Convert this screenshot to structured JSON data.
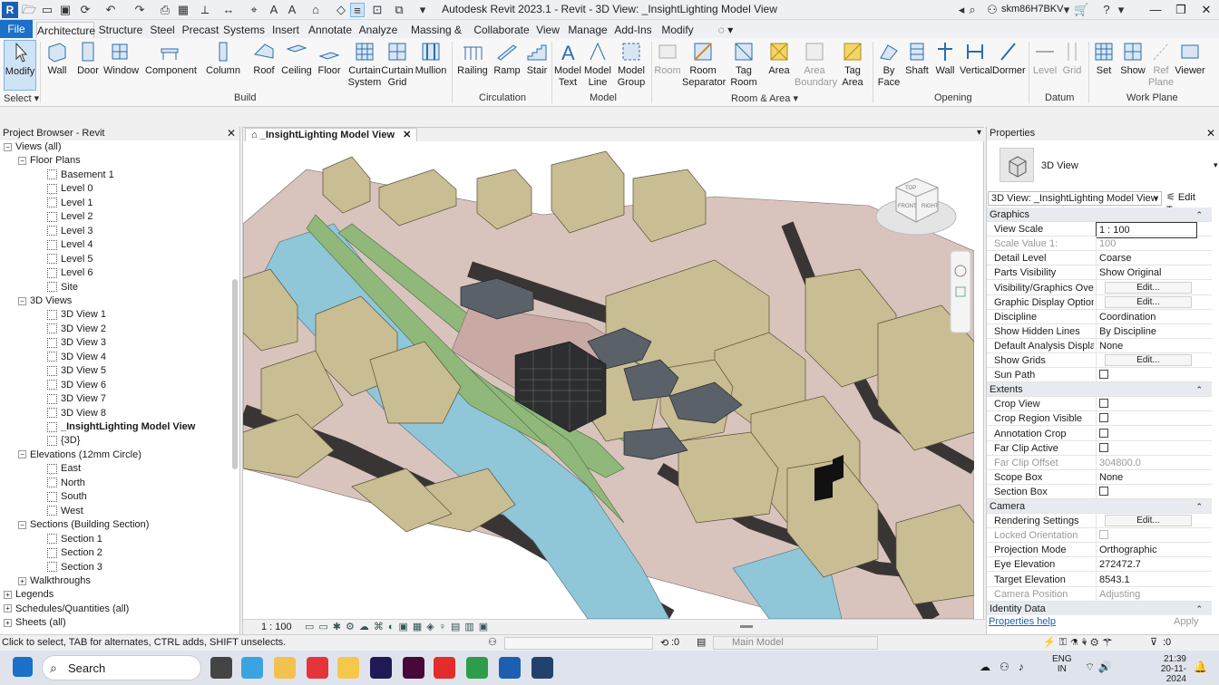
{
  "window": {
    "title": "Autodesk Revit 2023.1 - Revit - 3D View: _InsightLighting Model View",
    "user": "skm86H7BKV"
  },
  "tabs": [
    "File",
    "Architecture",
    "Structure",
    "Steel",
    "Precast",
    "Systems",
    "Insert",
    "Annotate",
    "Analyze",
    "Massing & Site",
    "Collaborate",
    "View",
    "Manage",
    "Add-Ins",
    "Modify"
  ],
  "active_tab": "Architecture",
  "ribbon": {
    "select": {
      "modify": "Modify",
      "label": "Select"
    },
    "build": {
      "label": "Build",
      "items": [
        "Wall",
        "Door",
        "Window",
        "Component",
        "Column",
        "Roof",
        "Ceiling",
        "Floor",
        "Curtain System",
        "Curtain Grid",
        "Mullion"
      ]
    },
    "circulation": {
      "label": "Circulation",
      "items": [
        "Railing",
        "Ramp",
        "Stair"
      ]
    },
    "model": {
      "label": "Model",
      "items": [
        "Model Text",
        "Model Line",
        "Model Group"
      ]
    },
    "room_area": {
      "label": "Room & Area",
      "items": [
        "Room",
        "Room Separator",
        "Tag Room",
        "Area",
        "Area Boundary",
        "Tag Area"
      ]
    },
    "opening": {
      "label": "Opening",
      "items": [
        "By Face",
        "Shaft",
        "Wall",
        "Vertical",
        "Dormer"
      ]
    },
    "datum": {
      "label": "Datum",
      "items": [
        "Level",
        "Grid"
      ]
    },
    "work_plane": {
      "label": "Work Plane",
      "items": [
        "Set",
        "Show",
        "Ref Plane",
        "Viewer"
      ]
    }
  },
  "project_browser": {
    "title": "Project Browser - Revit",
    "nodes": [
      {
        "label": "Views (all)",
        "level": 0,
        "type": "root"
      },
      {
        "label": "Floor Plans",
        "level": 1,
        "type": "group"
      },
      {
        "label": "Basement 1",
        "level": 2,
        "type": "view"
      },
      {
        "label": "Level 0",
        "level": 2,
        "type": "view"
      },
      {
        "label": "Level 1",
        "level": 2,
        "type": "view"
      },
      {
        "label": "Level 2",
        "level": 2,
        "type": "view"
      },
      {
        "label": "Level 3",
        "level": 2,
        "type": "view"
      },
      {
        "label": "Level 4",
        "level": 2,
        "type": "view"
      },
      {
        "label": "Level 5",
        "level": 2,
        "type": "view"
      },
      {
        "label": "Level 6",
        "level": 2,
        "type": "view"
      },
      {
        "label": "Site",
        "level": 2,
        "type": "view"
      },
      {
        "label": "3D Views",
        "level": 1,
        "type": "group"
      },
      {
        "label": "3D View 1",
        "level": 2,
        "type": "view"
      },
      {
        "label": "3D View 2",
        "level": 2,
        "type": "view"
      },
      {
        "label": "3D View 3",
        "level": 2,
        "type": "view"
      },
      {
        "label": "3D View 4",
        "level": 2,
        "type": "view"
      },
      {
        "label": "3D View 5",
        "level": 2,
        "type": "view"
      },
      {
        "label": "3D View 6",
        "level": 2,
        "type": "view"
      },
      {
        "label": "3D View 7",
        "level": 2,
        "type": "view"
      },
      {
        "label": "3D View 8",
        "level": 2,
        "type": "view"
      },
      {
        "label": "_InsightLighting Model View",
        "level": 2,
        "type": "view",
        "current": true
      },
      {
        "label": "{3D}",
        "level": 2,
        "type": "view"
      },
      {
        "label": "Elevations (12mm Circle)",
        "level": 1,
        "type": "group"
      },
      {
        "label": "East",
        "level": 2,
        "type": "view"
      },
      {
        "label": "North",
        "level": 2,
        "type": "view"
      },
      {
        "label": "South",
        "level": 2,
        "type": "view"
      },
      {
        "label": "West",
        "level": 2,
        "type": "view"
      },
      {
        "label": "Sections (Building Section)",
        "level": 1,
        "type": "group"
      },
      {
        "label": "Section 1",
        "level": 2,
        "type": "view"
      },
      {
        "label": "Section 2",
        "level": 2,
        "type": "view"
      },
      {
        "label": "Section 3",
        "level": 2,
        "type": "view"
      },
      {
        "label": "Walkthroughs",
        "level": 1,
        "type": "collapsed"
      },
      {
        "label": "Legends",
        "level": 0,
        "type": "collapsed"
      },
      {
        "label": "Schedules/Quantities (all)",
        "level": 0,
        "type": "collapsed"
      },
      {
        "label": "Sheets (all)",
        "level": 0,
        "type": "collapsed"
      }
    ]
  },
  "view": {
    "tab_title": "_InsightLighting Model View",
    "scale": "1 : 100",
    "viewcube_labels": [
      "TOP",
      "FRONT",
      "RIGHT"
    ]
  },
  "properties": {
    "title": "Properties",
    "type_name": "3D View",
    "instance": "3D View: _InsightLighting Model View",
    "edit_type": "Edit Type",
    "rows": [
      {
        "kind": "section",
        "label": "Graphics"
      },
      {
        "label": "View Scale",
        "value": "1 : 100",
        "field": true
      },
      {
        "label": "Scale Value    1:",
        "value": "100",
        "gray": true
      },
      {
        "label": "Detail Level",
        "value": "Coarse"
      },
      {
        "label": "Parts Visibility",
        "value": "Show Original"
      },
      {
        "label": "Visibility/Graphics Over...",
        "value": "Edit...",
        "button": true
      },
      {
        "label": "Graphic Display Options",
        "value": "Edit...",
        "button": true
      },
      {
        "label": "Discipline",
        "value": "Coordination"
      },
      {
        "label": "Show Hidden Lines",
        "value": "By Discipline"
      },
      {
        "label": "Default Analysis Display...",
        "value": "None"
      },
      {
        "label": "Show Grids",
        "value": "Edit...",
        "button": true
      },
      {
        "label": "Sun Path",
        "value": "",
        "check": true
      },
      {
        "kind": "section",
        "label": "Extents"
      },
      {
        "label": "Crop View",
        "value": "",
        "check": true
      },
      {
        "label": "Crop Region Visible",
        "value": "",
        "check": true
      },
      {
        "label": "Annotation Crop",
        "value": "",
        "check": true
      },
      {
        "label": "Far Clip Active",
        "value": "",
        "check": true
      },
      {
        "label": "Far Clip Offset",
        "value": "304800.0",
        "gray": true
      },
      {
        "label": "Scope Box",
        "value": "None"
      },
      {
        "label": "Section Box",
        "value": "",
        "check": true
      },
      {
        "kind": "section",
        "label": "Camera"
      },
      {
        "label": "Rendering Settings",
        "value": "Edit...",
        "button": true
      },
      {
        "label": "Locked Orientation",
        "value": "",
        "check": true,
        "gray": true
      },
      {
        "label": "Projection Mode",
        "value": "Orthographic"
      },
      {
        "label": "Eye Elevation",
        "value": "272472.7"
      },
      {
        "label": "Target Elevation",
        "value": "8543.1"
      },
      {
        "label": "Camera Position",
        "value": "Adjusting",
        "gray": true
      },
      {
        "kind": "section",
        "label": "Identity Data"
      }
    ],
    "help": "Properties help",
    "apply": "Apply"
  },
  "status": {
    "hint": "Click to select, TAB for alternates, CTRL adds, SHIFT unselects.",
    "workset": ":0",
    "model": "Main Model",
    "filter": ":0"
  },
  "taskbar": {
    "search": "Search",
    "lang1": "ENG",
    "lang2": "IN",
    "time": "21:39",
    "date": "20-11-2024"
  },
  "colors": {
    "accent": "#1c70c8",
    "terrain": "#d8c4bd",
    "building": "#c9bd93",
    "water": "#8fc6d8",
    "grass": "#8fb87a",
    "road": "#3a3535"
  }
}
